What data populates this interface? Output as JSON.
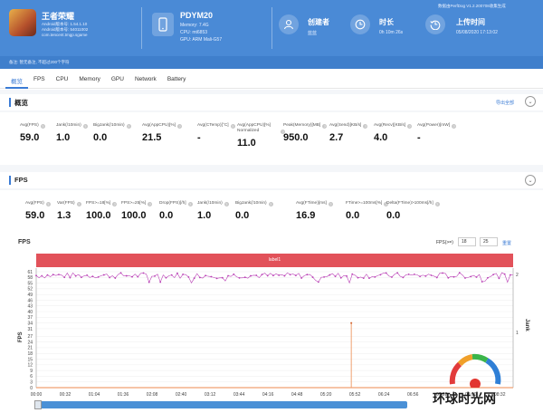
{
  "app": {
    "name": "王者荣耀",
    "meta_lines": [
      "Android版本号: 1.54.1.10",
      "Android版本号: 54011002",
      "com.tencent.tmgp.sgame"
    ]
  },
  "device": {
    "name": "PDYM20",
    "meta_lines": [
      "Memory: 7.4G",
      "CPU: mt6853",
      "GPU: ARM Mali-G57"
    ]
  },
  "creator": {
    "label": "创建者",
    "value": "蓝蓝"
  },
  "duration": {
    "label": "时长",
    "value": "0h 10m 26s"
  },
  "upload": {
    "label": "上传时间",
    "value": "05/08/2020 17:13:02"
  },
  "perfdog_note": "数据由PerfDog V1.2.200708收集生成",
  "notebar": "备注: 暂无备注, 不超过200个字符",
  "tabs": [
    "概览",
    "FPS",
    "CPU",
    "Memory",
    "GPU",
    "Network",
    "Battery"
  ],
  "overview": {
    "title": "概览",
    "export": "导出全部",
    "stats": [
      {
        "label": "Avg(FPS)",
        "value": "59.0"
      },
      {
        "label": "Jank(/10min)",
        "value": "1.0"
      },
      {
        "label": "BigJank(/10min)",
        "value": "0.0"
      },
      {
        "label": "Avg(AppCPU)[%]",
        "value": "21.5"
      },
      {
        "label": "Avg(CTemp)[°C]",
        "value": "-"
      },
      {
        "label": "Avg(AppCPU)[%] Normalized",
        "value": "11.0"
      },
      {
        "label": "Peak(Memory)[MB]",
        "value": "950.0"
      },
      {
        "label": "Avg(Send)[KB/s]",
        "value": "2.7"
      },
      {
        "label": "Avg(Recv)[KB/s]",
        "value": "4.0"
      },
      {
        "label": "Avg(Power)[mW]",
        "value": "-"
      }
    ]
  },
  "fps_section": {
    "title": "FPS",
    "stats": [
      {
        "label": "Avg(FPS)",
        "value": "59.0"
      },
      {
        "label": "Var(FPS)",
        "value": "1.3"
      },
      {
        "label": "FPS>=18[%]",
        "value": "100.0"
      },
      {
        "label": "FPS>=25[%]",
        "value": "100.0"
      },
      {
        "label": "Drop(FPS)[/h]",
        "value": "0.0"
      },
      {
        "label": "Jank(/10min)",
        "value": "1.0"
      },
      {
        "label": "BigJank(/10min)",
        "value": "0.0"
      },
      {
        "label": "Avg(FTime)[ms]",
        "value": "16.9"
      },
      {
        "label": "FTime>=100ms[%]",
        "value": "0.0"
      },
      {
        "label": "Delta(FTime)>100ms[/h]",
        "value": "0.0"
      }
    ]
  },
  "chart_header": {
    "title": "FPS",
    "filter_label": "FPS(>=)",
    "filter_a": "18",
    "filter_b": "25",
    "reset": "重置",
    "label_bar": "label1"
  },
  "chart_data": {
    "type": "line",
    "ylabel": "FPS",
    "y2label": "Jank",
    "ylim": [
      0,
      61
    ],
    "yticks": [
      0,
      3,
      6,
      9,
      12,
      15,
      18,
      21,
      24,
      27,
      31,
      34,
      37,
      40,
      43,
      46,
      49,
      52,
      55,
      58,
      61
    ],
    "y2lim": [
      0,
      2
    ],
    "y2ticks": [
      1,
      2
    ],
    "xticks": [
      "00:00",
      "00:32",
      "01:04",
      "01:36",
      "02:08",
      "02:40",
      "03:12",
      "03:44",
      "04:16",
      "04:48",
      "05:20",
      "05:52",
      "06:24",
      "06:56",
      "07:28",
      "08:00",
      "08:32"
    ],
    "series": [
      {
        "name": "FPS",
        "color": "#b93fb5",
        "avg": 59,
        "min": 55,
        "max": 61
      },
      {
        "name": "Jank",
        "color": "#f0a070",
        "baseline": 0,
        "spike_at": "05:52",
        "spike_value": 34
      }
    ]
  },
  "watermark": {
    "text": "环球时光网"
  }
}
